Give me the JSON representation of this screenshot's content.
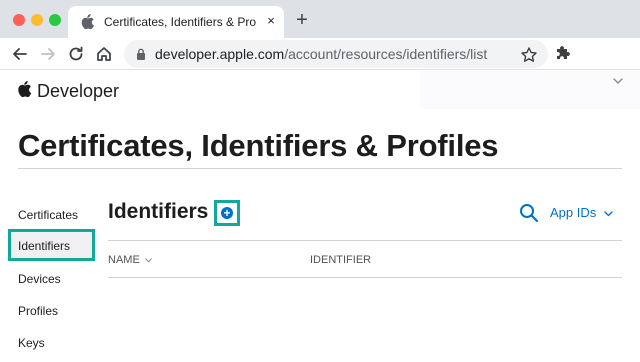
{
  "browser": {
    "tab_title": "Certificates, Identifiers & Profil",
    "tab_close": "×",
    "new_tab": "+",
    "url_host": "developer.apple.com",
    "url_path": "/account/resources/identifiers/list"
  },
  "site": {
    "brand": "Developer"
  },
  "page": {
    "title": "Certificates, Identifiers & Profiles"
  },
  "sidebar": {
    "items": [
      {
        "label": "Certificates"
      },
      {
        "label": "Identifiers",
        "selected": true
      },
      {
        "label": "Devices"
      },
      {
        "label": "Profiles"
      },
      {
        "label": "Keys"
      }
    ]
  },
  "main": {
    "section_title": "Identifiers",
    "add_symbol": "+",
    "filter_label": "App IDs",
    "columns": [
      {
        "label": "NAME"
      },
      {
        "label": "IDENTIFIER"
      }
    ]
  },
  "colors": {
    "accent": "#0070c9",
    "highlight_border": "#12a89a",
    "tab_bar": "#dee1e6"
  },
  "icons": [
    "apple-logo-icon",
    "lock-icon",
    "star-icon",
    "extensions-icon",
    "search-icon",
    "chevron-down-icon",
    "add-icon"
  ]
}
